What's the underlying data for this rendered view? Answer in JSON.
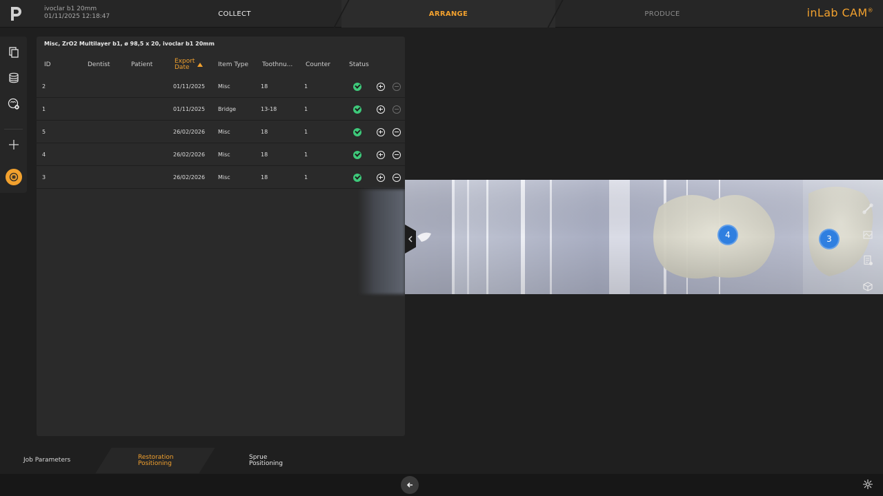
{
  "header": {
    "job_name": "ivoclar b1 20mm",
    "job_datetime": "01/11/2025 12:18:47",
    "steps": [
      "COLLECT",
      "ARRANGE",
      "PRODUCE"
    ],
    "active_step": "ARRANGE",
    "brand": "inLab CAM",
    "brand_mark": "®"
  },
  "colors": {
    "accent": "#f2a12e",
    "status_ok": "#3ec97a",
    "badge_blue": "#2f7fe0",
    "panel_bg": "#2a2a2a"
  },
  "left_toolbar": {
    "icons": [
      "copy-pages-icon",
      "database-icon",
      "tooth-export-icon",
      "add-icon",
      "material-block-icon"
    ]
  },
  "table": {
    "title": "Misc, ZrO2 Multilayer b1, ø 98,5 x 20, ivoclar b1 20mm",
    "columns": [
      "ID",
      "Dentist",
      "Patient",
      "Export Date",
      "Item Type",
      "Toothnu...",
      "Counter",
      "Status"
    ],
    "export_date_line1": "Export",
    "export_date_line2": "Date",
    "sorted_by": "Export Date",
    "rows": [
      {
        "id": "2",
        "dentist": "",
        "patient": "",
        "export_date": "01/11/2025",
        "item_type": "Misc",
        "tooth": "18",
        "counter": "1",
        "status": "ok",
        "remove_enabled": false
      },
      {
        "id": "1",
        "dentist": "",
        "patient": "",
        "export_date": "01/11/2025",
        "item_type": "Bridge",
        "tooth": "13-18",
        "counter": "1",
        "status": "ok",
        "remove_enabled": false
      },
      {
        "id": "5",
        "dentist": "",
        "patient": "",
        "export_date": "26/02/2026",
        "item_type": "Misc",
        "tooth": "18",
        "counter": "1",
        "status": "ok",
        "remove_enabled": true
      },
      {
        "id": "4",
        "dentist": "",
        "patient": "",
        "export_date": "26/02/2026",
        "item_type": "Misc",
        "tooth": "18",
        "counter": "1",
        "status": "ok",
        "remove_enabled": true
      },
      {
        "id": "3",
        "dentist": "",
        "patient": "",
        "export_date": "26/02/2026",
        "item_type": "Misc",
        "tooth": "18",
        "counter": "1",
        "status": "ok",
        "remove_enabled": true
      }
    ]
  },
  "viewport": {
    "badges": [
      "4",
      "3"
    ],
    "right_tools": [
      "bone-icon",
      "image-frame-icon",
      "report-icon",
      "cube-icon"
    ]
  },
  "subtabs": {
    "job_parameters": "Job Parameters",
    "restoration_line1": "Restoration",
    "restoration_line2": "Positioning",
    "sprue_line1": "Sprue",
    "sprue_line2": "Positioning",
    "active": "Restoration Positioning"
  }
}
